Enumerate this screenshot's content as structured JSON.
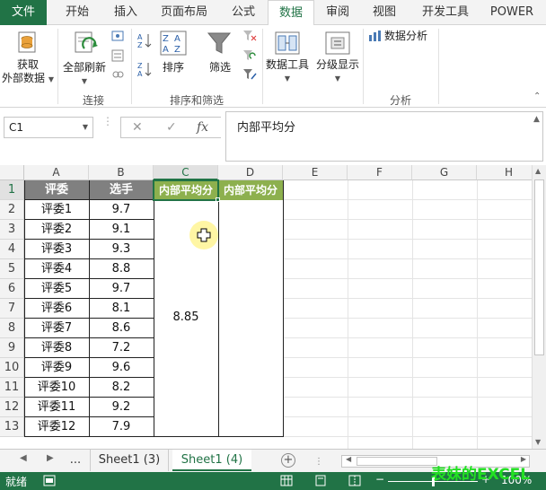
{
  "tabs": [
    "文件",
    "开始",
    "插入",
    "页面布局",
    "公式",
    "数据",
    "审阅",
    "视图",
    "开发工具",
    "POWER"
  ],
  "active_tab": "数据",
  "ribbon": {
    "get_external_line1": "获取",
    "get_external_line2": "外部数据",
    "refresh_all": "全部刷新",
    "group_connections": "连接",
    "sort": "排序",
    "filter": "筛选",
    "group_sort_filter": "排序和筛选",
    "data_tools": "数据工具",
    "outline": "分级显示",
    "data_analysis": "数据分析",
    "group_analysis": "分析"
  },
  "formula_bar": {
    "name_box": "C1",
    "cancel_symbol": "✕",
    "enter_symbol": "✓",
    "fx_symbol": "fx",
    "content": "内部平均分"
  },
  "columns": [
    "A",
    "B",
    "C",
    "D",
    "E",
    "F",
    "G",
    "H"
  ],
  "selected_column": "C",
  "rows": [
    "1",
    "2",
    "3",
    "4",
    "5",
    "6",
    "7",
    "8",
    "9",
    "10",
    "11",
    "12",
    "13"
  ],
  "table": {
    "headers": [
      "评委",
      "选手",
      "内部平均分",
      "内部平均分"
    ],
    "judges": [
      "评委1",
      "评委2",
      "评委3",
      "评委4",
      "评委5",
      "评委6",
      "评委7",
      "评委8",
      "评委9",
      "评委10",
      "评委11",
      "评委12"
    ],
    "scores": [
      "9.7",
      "9.1",
      "9.3",
      "8.8",
      "9.7",
      "8.1",
      "8.6",
      "7.2",
      "9.6",
      "8.2",
      "9.2",
      "7.9"
    ],
    "merged_average": "8.85"
  },
  "sheets": {
    "ellipsis": "...",
    "sheet_a": "Sheet1 (3)",
    "sheet_b": "Sheet1 (4)",
    "active": "Sheet1 (4)",
    "add_symbol": "+"
  },
  "status": {
    "ready": "就绪",
    "zoom": "100%",
    "zoom_level": 1.0
  },
  "watermark": "表妹的EXCEL",
  "colors": {
    "excel_green": "#217346",
    "header_gray": "#808080",
    "header_green": "#8db04e",
    "highlight_yellow": "#fff59a"
  }
}
